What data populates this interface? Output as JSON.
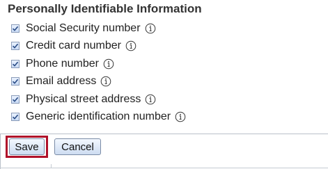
{
  "section": {
    "title": "Personally Identifiable Information"
  },
  "options": [
    {
      "label": "Social Security number",
      "checked": true,
      "info_icon": "info-circle-icon"
    },
    {
      "label": "Credit card number",
      "checked": true,
      "info_icon": "info-circle-icon"
    },
    {
      "label": "Phone number",
      "checked": true,
      "info_icon": "info-circle-icon"
    },
    {
      "label": "Email address",
      "checked": true,
      "info_icon": "info-circle-icon"
    },
    {
      "label": "Physical street address",
      "checked": true,
      "info_icon": "info-circle-icon"
    },
    {
      "label": "Generic identification number",
      "checked": true,
      "info_icon": "info-circle-icon"
    }
  ],
  "actions": {
    "save_label": "Save",
    "cancel_label": "Cancel"
  },
  "colors": {
    "highlight": "#b0112a",
    "button_border": "#7a8ba6",
    "checkbox_check": "#2b4d86"
  }
}
